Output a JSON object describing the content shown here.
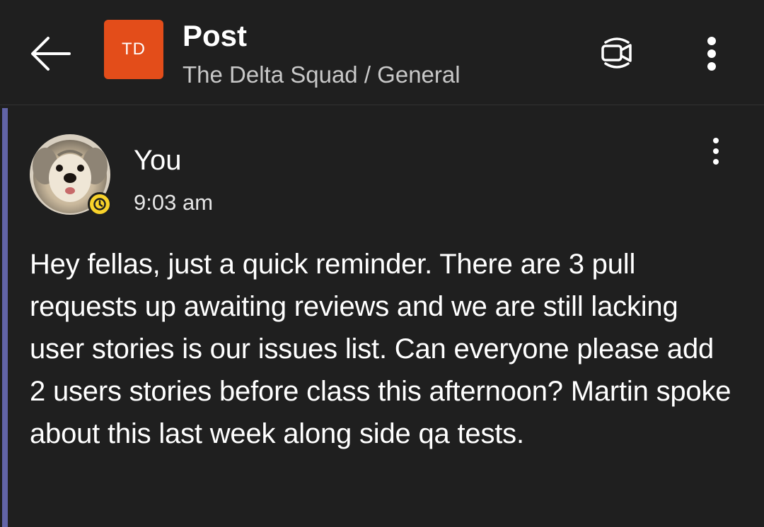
{
  "header": {
    "back_icon": "arrow-left-icon",
    "team_initials": "TD",
    "team_color": "#e34d1a",
    "title": "Post",
    "subtitle": "The Delta Squad / General",
    "video_icon": "video-call-icon",
    "more_icon": "more-vertical-icon"
  },
  "post": {
    "accent_color": "#6264a7",
    "author": "You",
    "time": "9:03 am",
    "status": "away",
    "status_color": "#f8d22a",
    "more_icon": "more-vertical-icon",
    "message": "Hey fellas, just a quick reminder. There are 3 pull requests up awaiting reviews and we are still lacking user stories is our issues list. Can everyone please add 2 users stories before class this afternoon? Martin spoke about this last week along side qa tests."
  }
}
